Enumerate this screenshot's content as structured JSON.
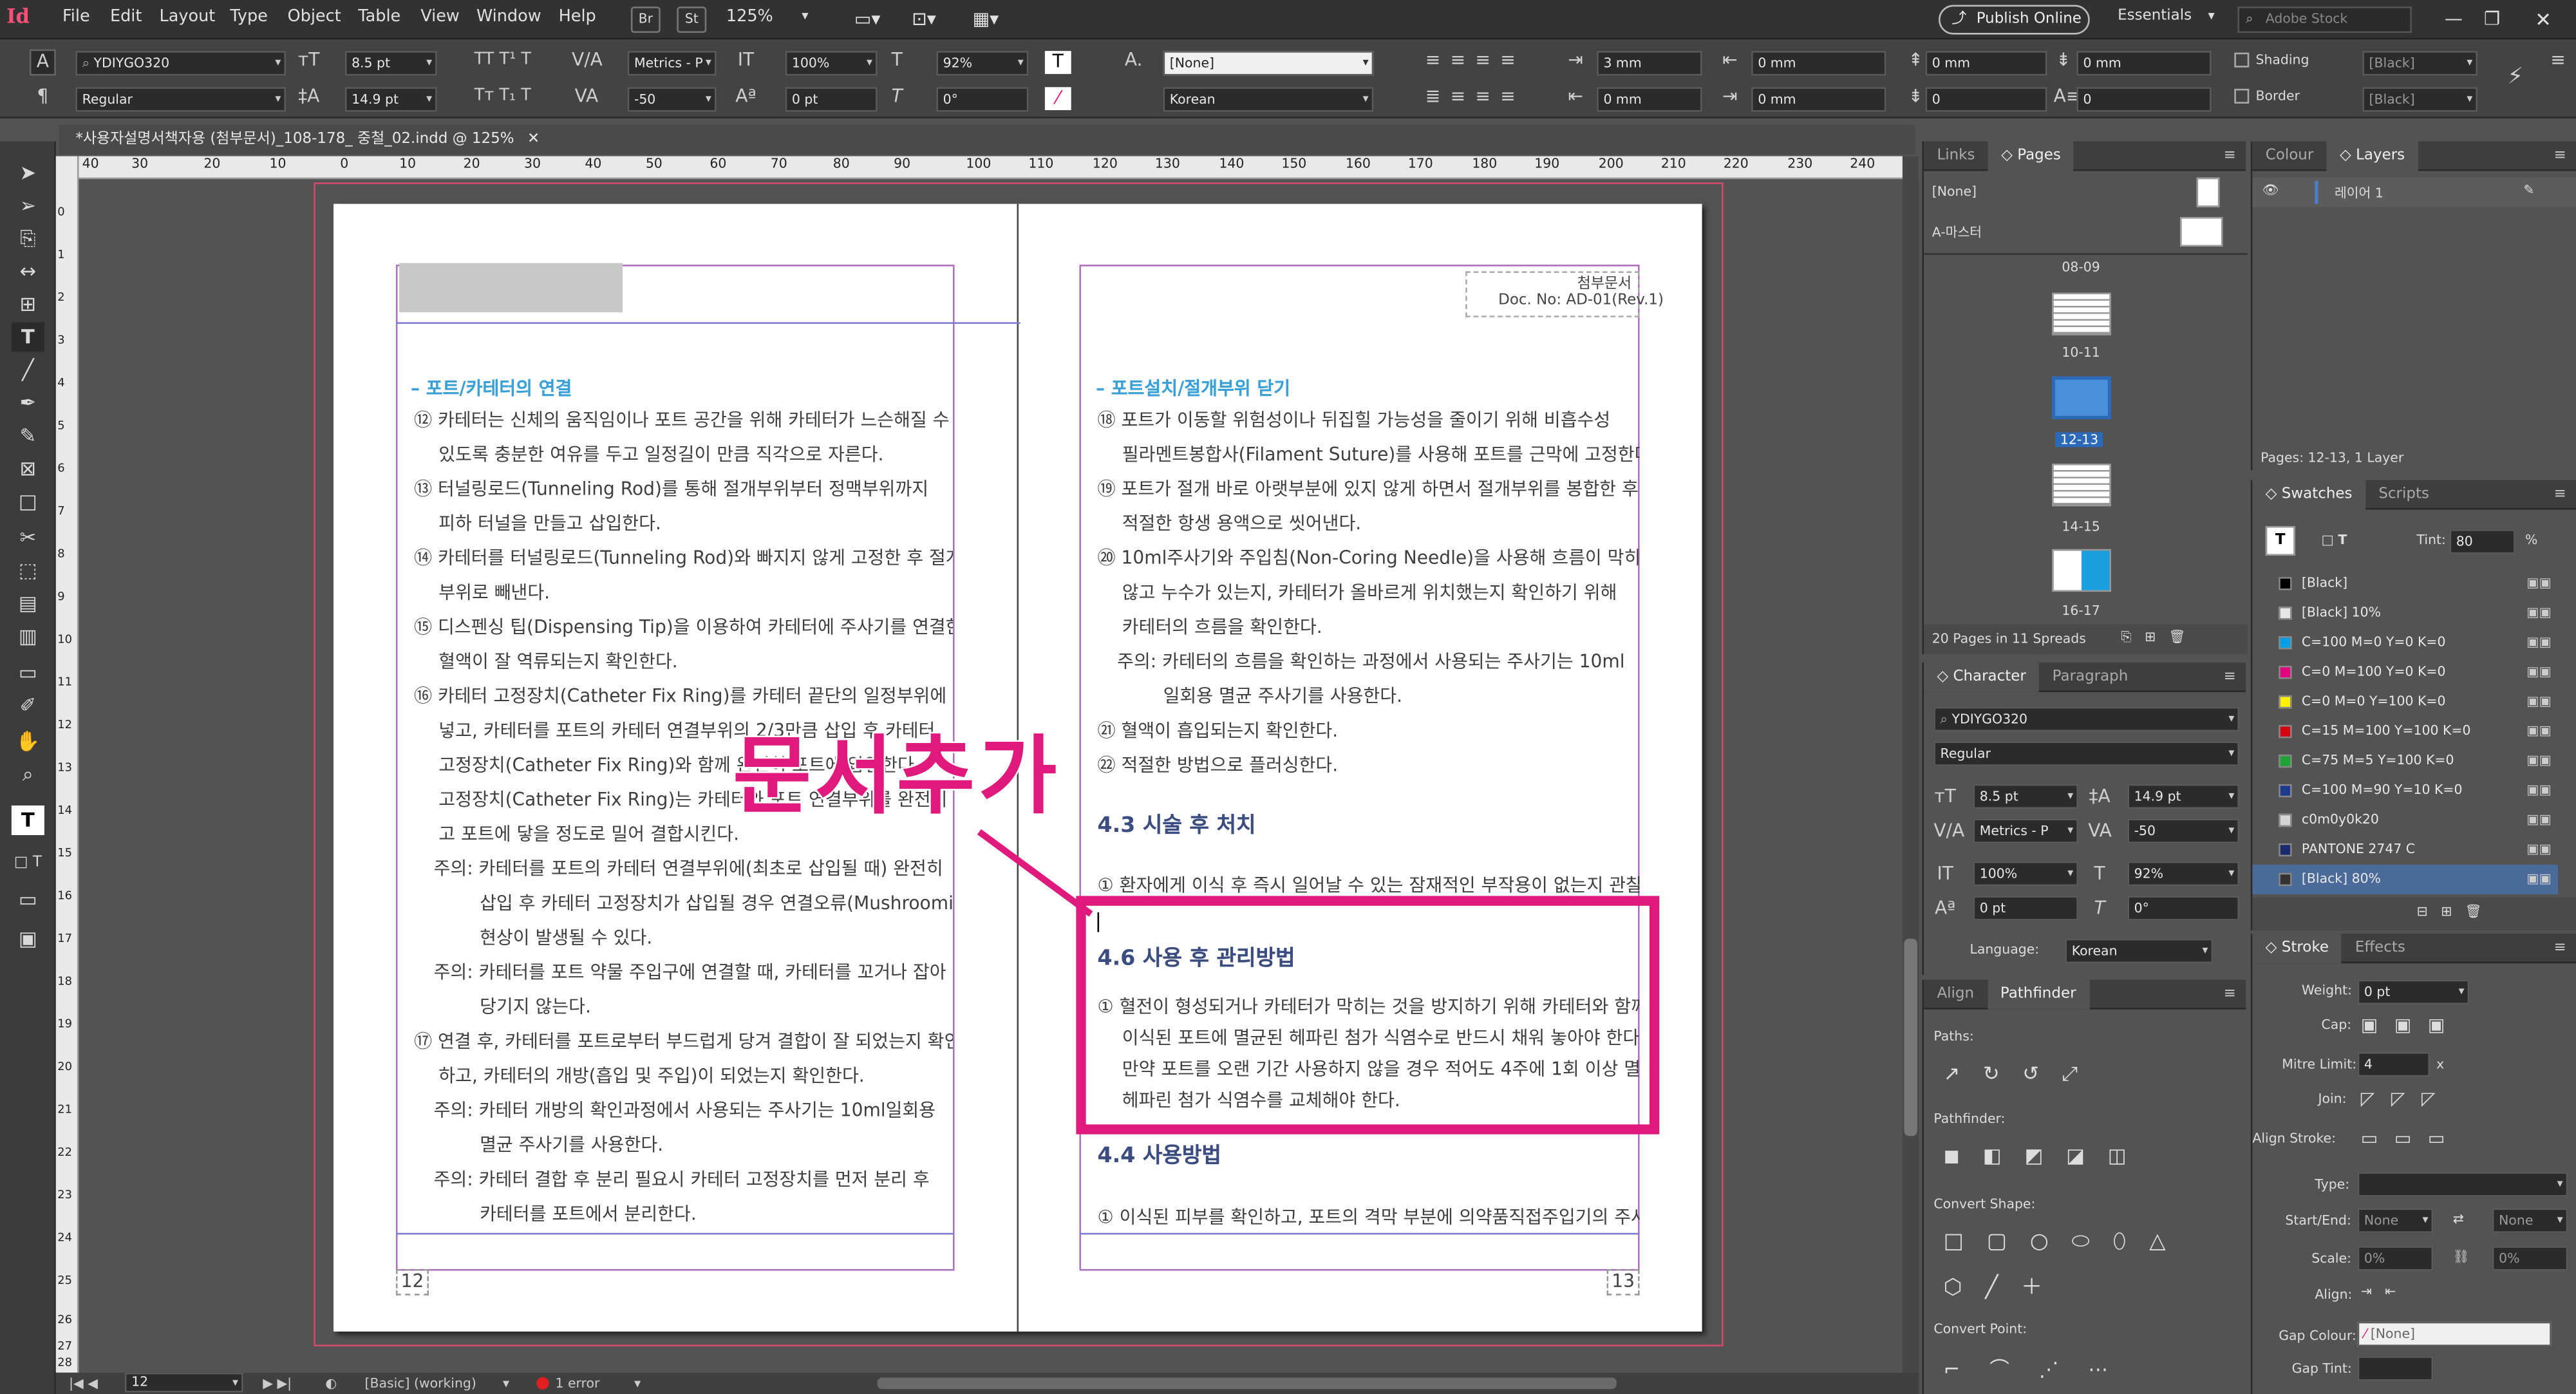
{
  "app": {
    "name": "Id",
    "menu": [
      "File",
      "Edit",
      "Layout",
      "Type",
      "Object",
      "Table",
      "View",
      "Window",
      "Help"
    ],
    "zoom": "125%",
    "publish": "Publish Online",
    "workspace": "Essentials",
    "stock_search": "Adobe Stock",
    "br": "Br",
    "st": "St"
  },
  "control": {
    "font": "YDIYGO320",
    "style": "Regular",
    "size": "8.5 pt",
    "leading": "14.9 pt",
    "kerning": "Metrics - P",
    "tracking": "-50",
    "vscale": "100%",
    "hscale": "92%",
    "baseline": "0 pt",
    "skew": "0°",
    "para_style": "[None]",
    "language": "Korean",
    "indent_l": "3 mm",
    "indent_r": "0 mm",
    "indent_1": "0 mm",
    "indent_last": "0 mm",
    "space_b": "0 mm",
    "space_a": "0 mm",
    "space_b2": "0 mm",
    "space_a2": "0 mm",
    "drop_1": "0",
    "drop_2": "0",
    "shading": "Shading",
    "border": "Border",
    "shade_swatch": "[Black]",
    "border_swatch": "[Black]"
  },
  "document": {
    "tab": "*사용자설명서책자용 (첨부문서)_108-178_ 중철_02.indd @ 125%",
    "ruler": [
      "40",
      "30",
      "20",
      "10",
      "0",
      "10",
      "20",
      "30",
      "40",
      "50",
      "60",
      "70",
      "80",
      "90",
      "100",
      "110",
      "120",
      "130",
      "140",
      "150",
      "160",
      "170",
      "180",
      "190",
      "200",
      "210",
      "220",
      "230",
      "240"
    ],
    "vruler": [
      "0",
      "1",
      "2",
      "3",
      "4",
      "5",
      "6",
      "7",
      "8",
      "9",
      "10",
      "11",
      "12",
      "13",
      "14",
      "15",
      "16",
      "17",
      "18",
      "19",
      "20",
      "21",
      "22",
      "23",
      "24",
      "25",
      "26",
      "27",
      "28"
    ]
  },
  "left_page": {
    "section": "– 포트/카테터의 연결",
    "lines": [
      "⑫ 카테터는 신체의 움직임이나 포트 공간을 위해 카테터가 느슨해질 수",
      "있도록 충분한 여유를 두고 일정길이 만큼 직각으로 자른다.",
      "⑬ 터널링로드(Tunneling Rod)를 통해 절개부위부터 정맥부위까지",
      "피하 터널을 만들고 삽입한다.",
      "⑭ 카테터를 터널링로드(Tunneling Rod)와 빠지지 않게 고정한 후 절개",
      "부위로 빼낸다.",
      "⑮ 디스펜싱 팁(Dispensing Tip)을 이용하여 카테터에 주사기를 연결한 후",
      "혈액이 잘 역류되는지 확인한다.",
      "⑯ 카테터 고정장치(Catheter Fix Ring)를 카테터 끝단의 일정부위에 밀어",
      "넣고, 카테터를 포트의 카테터 연결부위의 2/3만큼 삽입 후 카테터",
      "고정장치(Catheter Fix Ring)와 함께 완전히 포트에 압입한다.",
      "고정장치(Catheter Fix Ring)는 카테터와 포트 연결부위를 완전히 덮",
      "고 포트에 닿을 정도로 밀어 결합시킨다.",
      "주의: 카테터를 포트의 카테터 연결부위에(최초로 삽입될 때) 완전히",
      "삽입 후 카테터 고정장치가 삽입될 경우 연결오류(Mushrooming)",
      "현상이 발생될 수 있다.",
      "주의: 카테터를 포트 약물 주입구에 연결할 때, 카테터를 꼬거나 잡아",
      "당기지 않는다.",
      "⑰ 연결 후, 카테터를 포트로부터 부드럽게 당겨 결합이 잘 되었는지 확인",
      "하고, 카테터의 개방(흡입 및 주입)이 되었는지 확인한다.",
      "주의: 카테터 개방의 확인과정에서 사용되는 주사기는 10ml일회용",
      "멸균 주사기를 사용한다.",
      "주의: 카테터 결합 후 분리 필요시 카테터 고정장치를 먼저 분리 후",
      "카테터를 포트에서 분리한다."
    ],
    "page_num": "12"
  },
  "right_page": {
    "header1": "첨부문서",
    "header2": "Doc. No: AD-01(Rev.1)",
    "section": "– 포트설치/절개부위 닫기",
    "lines": [
      "⑱ 포트가 이동할 위험성이나 뒤집힐 가능성을 줄이기 위해 비흡수성",
      "필라멘트봉합사(Filament Suture)를 사용해 포트를 근막에 고정한다.",
      "⑲ 포트가 절개 바로 아랫부분에 있지 않게 하면서 절개부위를 봉합한 후",
      "적절한 항생 용액으로 씻어낸다.",
      "⑳ 10ml주사기와 주입침(Non-Coring Needle)을 사용해 흐름이 막히지",
      "않고 누수가 있는지, 카테터가 올바르게 위치했는지 확인하기 위해",
      "카테터의 흐름을 확인한다.",
      "주의: 카테터의 흐름을 확인하는 과정에서 사용되는 주사기는 10ml",
      "일회용 멸균 주사기를 사용한다.",
      "㉑ 혈액이 흡입되는지 확인한다.",
      "㉒ 적절한 방법으로 플러싱한다."
    ],
    "h43": "4.3 시술 후 처치",
    "l43": "① 환자에게 이식 후 즉시 일어날 수 있는 잠재적인 부작용이 없는지 관찰한다.",
    "h46": "4.6 사용 후 관리방법",
    "l46": [
      "① 혈전이 형성되거나 카테터가 막히는 것을 방지하기 위해 카테터와 함께",
      "이식된 포트에 멸균된 헤파린 첨가 식염수로 반드시 채워 놓아야 한다.",
      "만약 포트를 오랜 기간 사용하지 않을 경우 적어도 4주에 1회 이상 멸균된",
      "헤파린 첨가 식염수를 교체해야 한다."
    ],
    "h44": "4.4 사용방법",
    "l44": "① 이식된 피부를 확인하고, 포트의 격막 부분에 의약품직접주입기의 주사",
    "page_num": "13"
  },
  "annotation": {
    "text": "문서추가",
    "color": "#e0197d"
  },
  "status": {
    "page": "12",
    "style": "[Basic] (working)",
    "errors": "1 error"
  },
  "pages_panel": {
    "tabs": [
      "Links",
      "Pages"
    ],
    "none": "[None]",
    "master": "A-마스터",
    "spreads": [
      "08-09",
      "10-11",
      "12-13",
      "14-15",
      "16-17"
    ],
    "info": "Pages: 12-13, 1 Layer",
    "count": "20 Pages in 11 Spreads"
  },
  "layers_panel": {
    "tabs": [
      "Colour",
      "Layers"
    ],
    "layer": "레이어 1"
  },
  "character_panel": {
    "tabs": [
      "Character",
      "Paragraph"
    ],
    "font": "YDIYGO320",
    "style": "Regular",
    "size": "8.5 pt",
    "leading": "14.9 pt",
    "kerning": "Metrics - P",
    "tracking": "-50",
    "vscale": "100%",
    "hscale": "92%",
    "baseline": "0 pt",
    "skew": "0°",
    "language_label": "Language:",
    "language": "Korean"
  },
  "align_panel": {
    "tabs": [
      "Align",
      "Pathfinder"
    ],
    "paths": "Paths:",
    "pathfinder": "Pathfinder:",
    "convert_shape": "Convert Shape:",
    "convert_point": "Convert Point:"
  },
  "swatches_panel": {
    "tabs": [
      "Swatches",
      "Scripts"
    ],
    "tint_label": "Tint:",
    "tint": "80",
    "items": [
      {
        "name": "[Black]",
        "color": "#000000"
      },
      {
        "name": "[Black] 10%",
        "color": "#e6e6e6"
      },
      {
        "name": "C=100 M=0 Y=0 K=0",
        "color": "#00a0e9"
      },
      {
        "name": "C=0 M=100 Y=0 K=0",
        "color": "#e4007f"
      },
      {
        "name": "C=0 M=0 Y=100 K=0",
        "color": "#fff100"
      },
      {
        "name": "C=15 M=100 Y=100 K=0",
        "color": "#d7000f"
      },
      {
        "name": "C=75 M=5 Y=100 K=0",
        "color": "#1ea337"
      },
      {
        "name": "C=100 M=90 Y=10 K=0",
        "color": "#1d3a8f"
      },
      {
        "name": "c0m0y0k20",
        "color": "#d4d4d4"
      },
      {
        "name": "PANTONE 2747 C",
        "color": "#1a2a6c"
      },
      {
        "name": "[Black] 80%",
        "color": "#333333"
      }
    ]
  },
  "stroke_panel": {
    "tabs": [
      "Stroke",
      "Effects"
    ],
    "weight_label": "Weight:",
    "weight": "0 pt",
    "cap": "Cap:",
    "mitre_label": "Mitre Limit:",
    "mitre": "4",
    "join": "Join:",
    "align_stroke": "Align Stroke:",
    "type": "Type:",
    "startend": "Start/End:",
    "start": "None",
    "end": "None",
    "scale": "Scale:",
    "scale1": "0%",
    "scale2": "0%",
    "align": "Align:",
    "gap_colour": "Gap Colour:",
    "gap_swatch": "[None]",
    "gap_tint": "Gap Tint:",
    "mult": "x"
  }
}
